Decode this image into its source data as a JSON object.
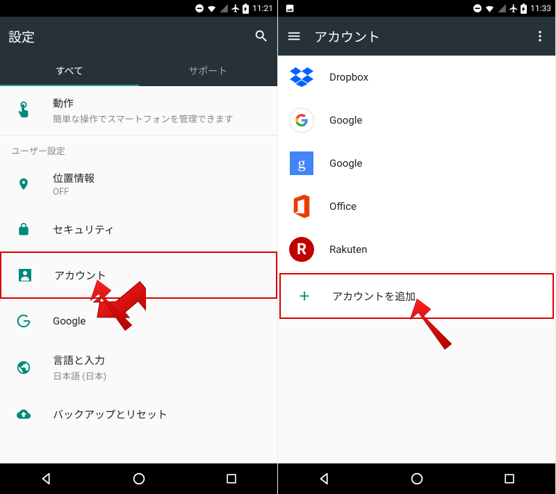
{
  "left": {
    "status": {
      "time": "11:21"
    },
    "appbar": {
      "title": "設定"
    },
    "tabs": {
      "all": "すべて",
      "support": "サポート"
    },
    "items": {
      "motion": {
        "title": "動作",
        "sub": "簡単な操作でスマートフォンを管理できます"
      },
      "subheader": "ユーザー設定",
      "location": {
        "title": "位置情報",
        "sub": "OFF"
      },
      "security": {
        "title": "セキュリティ"
      },
      "account": {
        "title": "アカウント"
      },
      "google": {
        "title": "Google"
      },
      "language": {
        "title": "言語と入力",
        "sub": "日本語 (日本)"
      },
      "backup": {
        "title": "バックアップとリセット"
      }
    }
  },
  "right": {
    "status": {
      "time": "11:33"
    },
    "appbar": {
      "title": "アカウント"
    },
    "accounts": {
      "dropbox": "Dropbox",
      "google1": "Google",
      "google2": "Google",
      "office": "Office",
      "rakuten": "Rakuten",
      "add": "アカウントを追加"
    }
  }
}
